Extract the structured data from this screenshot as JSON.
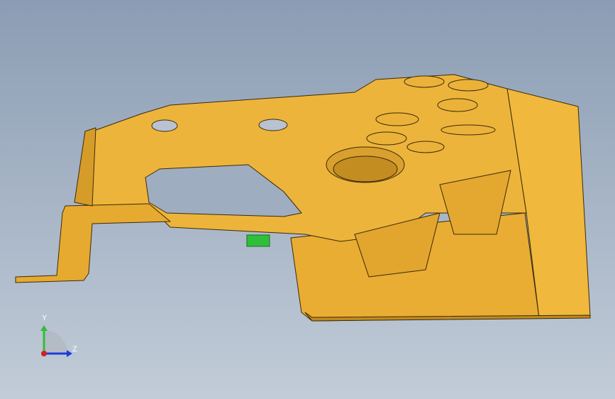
{
  "viewport": {
    "background_top": "#8b9db4",
    "background_bottom": "#c2ccd8"
  },
  "model": {
    "part_type": "stamped-sheet-metal-bracket",
    "color": "#ebb23a",
    "shadow_color": "#c89324",
    "edge_color": "#3b2a08",
    "marker_color": "#2fbf3a"
  },
  "triad": {
    "y_label": "Y",
    "z_label": "Z",
    "y_color": "#2fbf3a",
    "z_color": "#1d3fd8",
    "x_color": "#d42020"
  }
}
